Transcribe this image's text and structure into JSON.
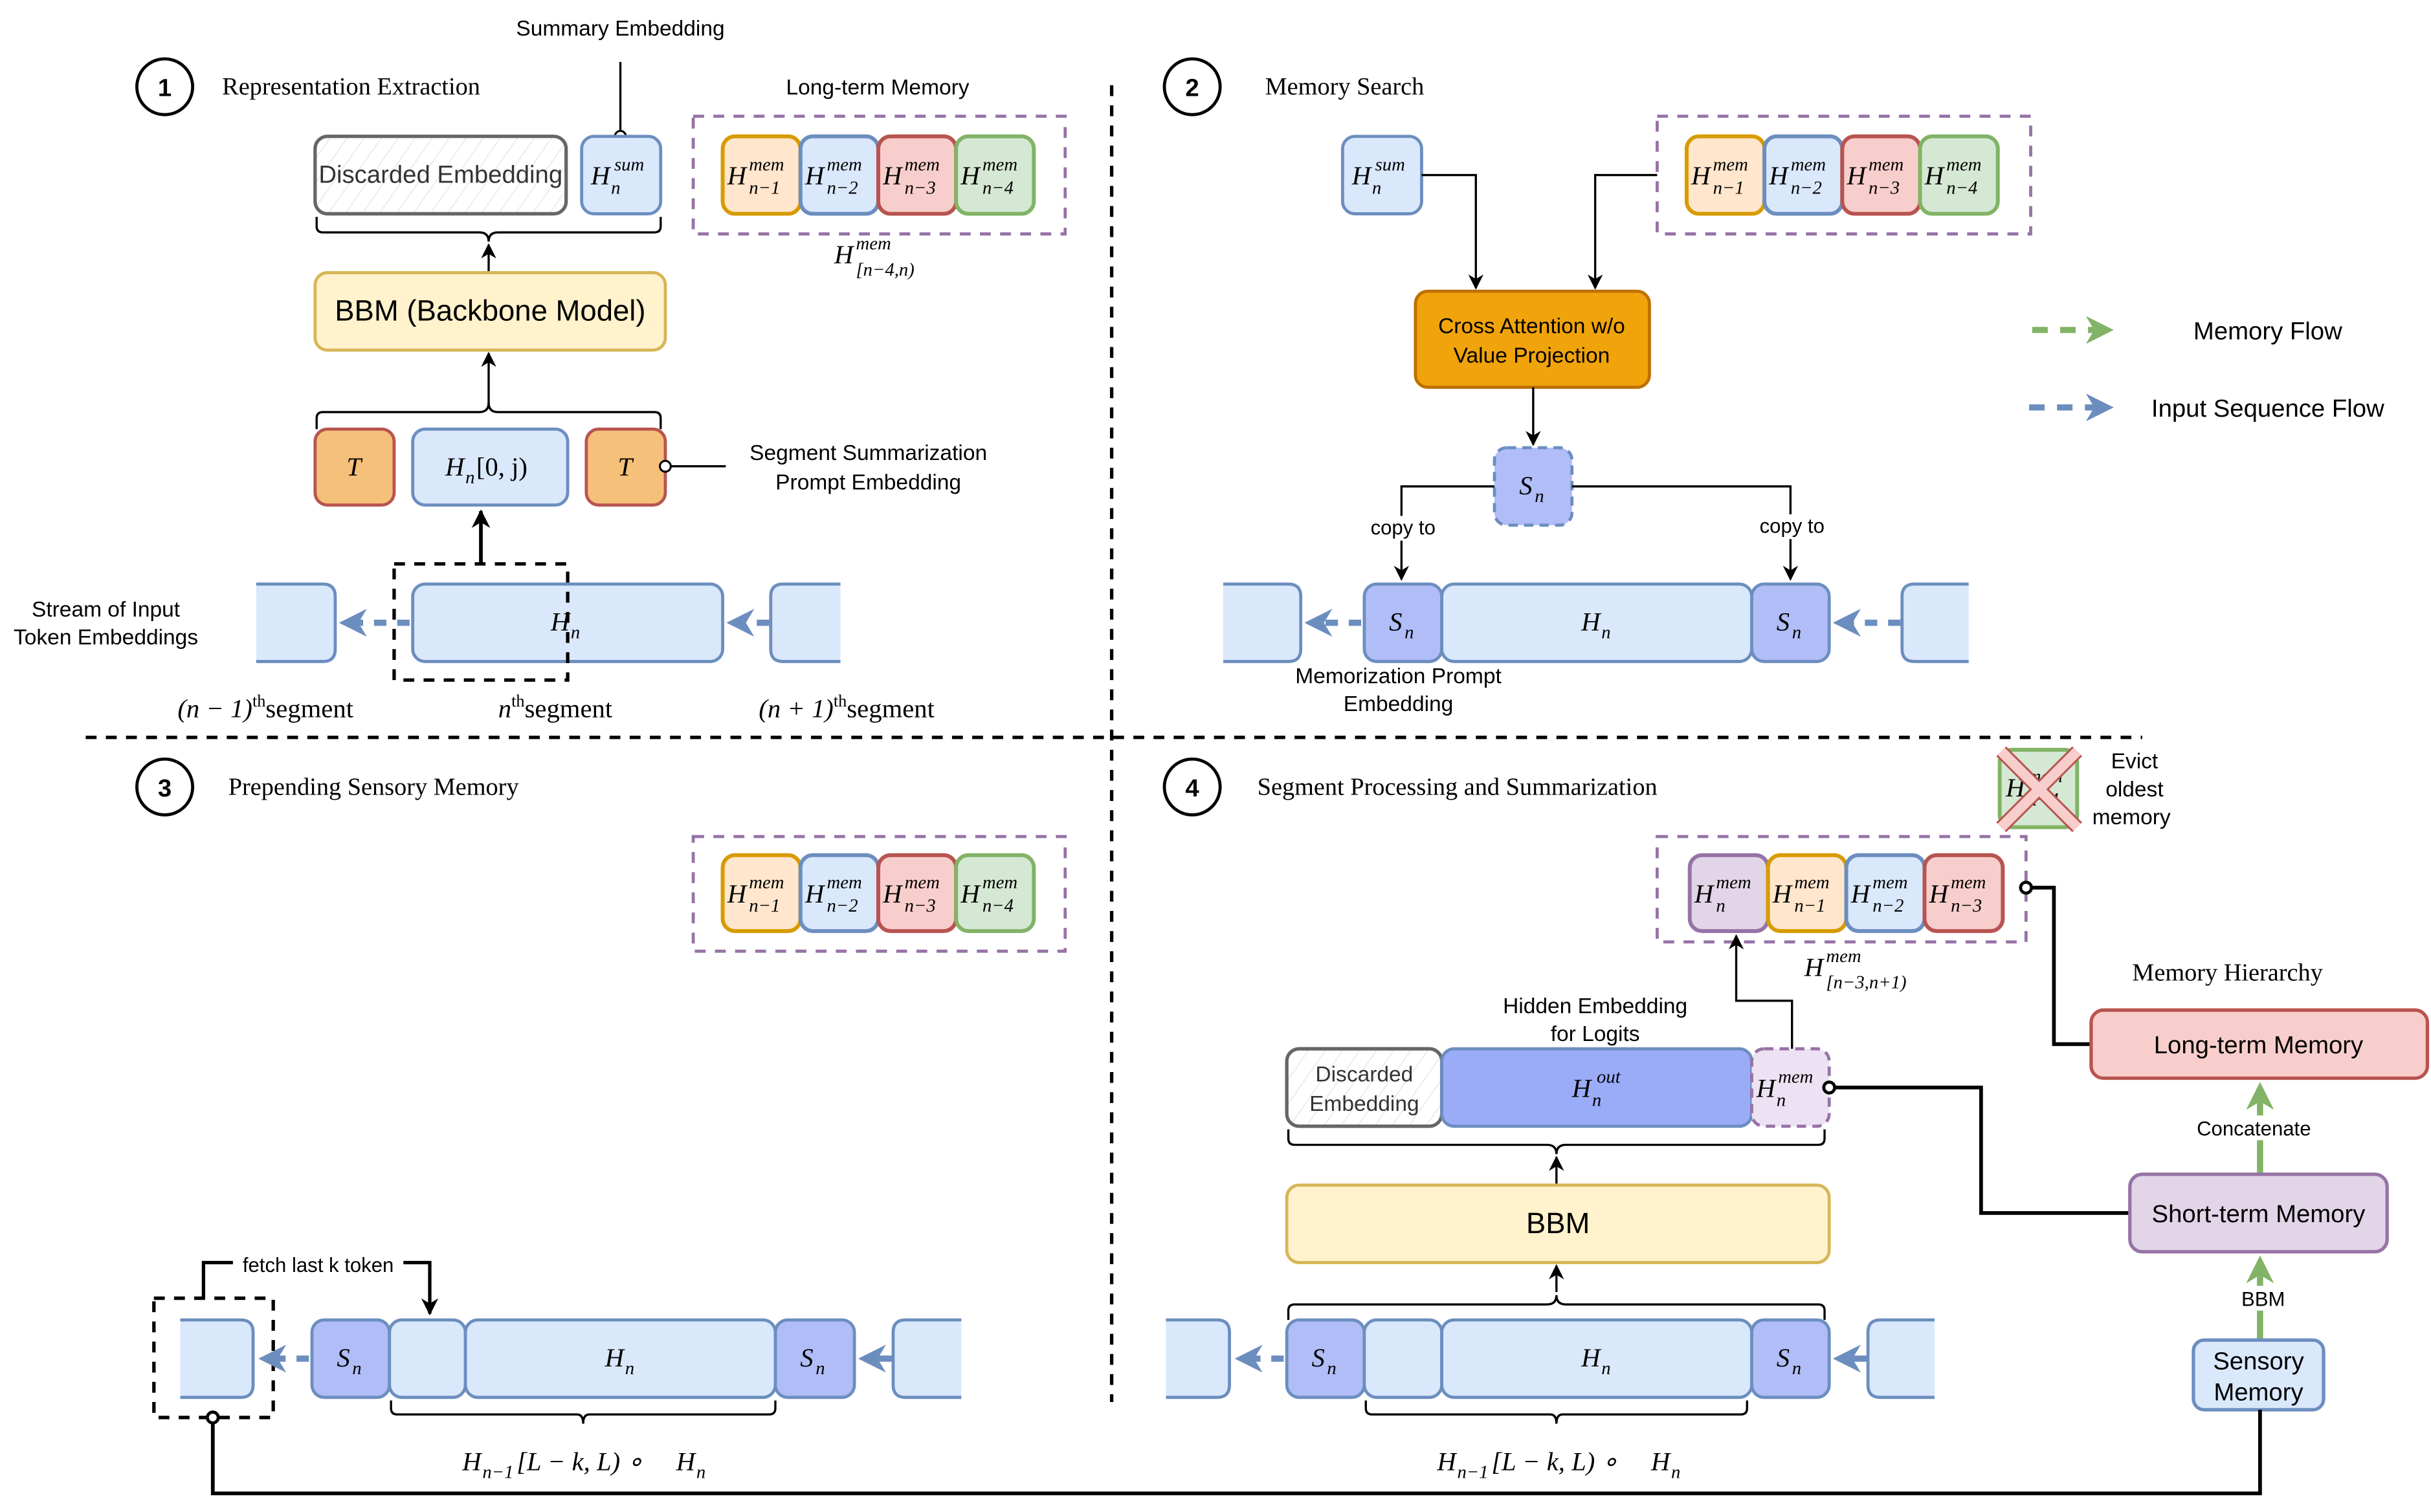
{
  "colors": {
    "blue_fill": "#dae8fc",
    "blue_stroke": "#6c8ebf",
    "sn_fill": "#b0bdf7",
    "hout_fill": "#9aabf8",
    "orange_fill": "#ffe6cc",
    "orange_stroke": "#d79b00",
    "red_fill": "#f8cecc",
    "red_stroke": "#b85450",
    "green_fill": "#d5e8d4",
    "green_stroke": "#82b366",
    "purple_fill": "#e1d5e7",
    "purple_stroke": "#9673a6",
    "t_fill": "#f5c07a",
    "cross_fill": "#f0a30a",
    "cross_stroke": "#bd7000",
    "bbm_fill": "#fff2cc",
    "bbm_stroke": "#d6b656",
    "memory_flow": "#82b366",
    "input_flow": "#6c8ebf"
  },
  "panel1": {
    "number": "1",
    "title": "Representation Extraction",
    "summary_embedding_label": "Summary Embedding",
    "discarded_label": "Discarded Embedding",
    "hsum": {
      "base": "H",
      "sup": "sum",
      "sub": "n"
    },
    "long_term_memory_label": "Long-term Memory",
    "memory_items": [
      {
        "base": "H",
        "sup": "mem",
        "sub": "n−1",
        "color": "orange"
      },
      {
        "base": "H",
        "sup": "mem",
        "sub": "n−2",
        "color": "blue"
      },
      {
        "base": "H",
        "sup": "mem",
        "sub": "n−3",
        "color": "red"
      },
      {
        "base": "H",
        "sup": "mem",
        "sub": "n−4",
        "color": "green"
      }
    ],
    "memory_range": {
      "base": "H",
      "sup": "mem",
      "sub": "[n−4,n)"
    },
    "bbm_label": "BBM (Backbone Model)",
    "token_t": "T",
    "hn_slice": {
      "base": "H",
      "sub": "n",
      "suffix": "[0, j)"
    },
    "segment_prompt_label": [
      "Segment Summarization",
      "Prompt Embedding"
    ],
    "stream_label": [
      "Stream of Input",
      "Token Embeddings"
    ],
    "hn": {
      "base": "H",
      "sub": "n"
    },
    "segment_labels": [
      {
        "math": "(n − 1)",
        "sup": "th",
        "text": "segment"
      },
      {
        "math": "n",
        "sup": "th",
        "text": "segment"
      },
      {
        "math": "(n + 1)",
        "sup": "th",
        "text": "segment"
      }
    ]
  },
  "panel2": {
    "number": "2",
    "title": "Memory Search",
    "hsum": {
      "base": "H",
      "sup": "sum",
      "sub": "n"
    },
    "memory_items": [
      {
        "base": "H",
        "sup": "mem",
        "sub": "n−1",
        "color": "orange"
      },
      {
        "base": "H",
        "sup": "mem",
        "sub": "n−2",
        "color": "blue"
      },
      {
        "base": "H",
        "sup": "mem",
        "sub": "n−3",
        "color": "red"
      },
      {
        "base": "H",
        "sup": "mem",
        "sub": "n−4",
        "color": "green"
      }
    ],
    "cross_attention_label": [
      "Cross Attention w/o",
      "Value Projection"
    ],
    "sn": {
      "base": "S",
      "sub": "n"
    },
    "copy_to_label": "copy to",
    "hn": {
      "base": "H",
      "sub": "n"
    },
    "memorization_prompt_label": [
      "Memorization Prompt",
      "Embedding"
    ]
  },
  "legend": {
    "items": [
      {
        "label": "Memory Flow",
        "color": "#82b366"
      },
      {
        "label": "Input Sequence Flow",
        "color": "#6c8ebf"
      }
    ]
  },
  "panel3": {
    "number": "3",
    "title": "Prepending Sensory Memory",
    "memory_items": [
      {
        "base": "H",
        "sup": "mem",
        "sub": "n−1",
        "color": "orange"
      },
      {
        "base": "H",
        "sup": "mem",
        "sub": "n−2",
        "color": "blue"
      },
      {
        "base": "H",
        "sup": "mem",
        "sub": "n−3",
        "color": "red"
      },
      {
        "base": "H",
        "sup": "mem",
        "sub": "n−4",
        "color": "green"
      }
    ],
    "fetch_label": "fetch last k token",
    "sn": {
      "base": "S",
      "sub": "n"
    },
    "hn": {
      "base": "H",
      "sub": "n"
    },
    "concat_label": {
      "base": "H",
      "sub": "n−1",
      "mid": "[L − k, L) ∘ ",
      "base2": "H",
      "sub2": "n"
    }
  },
  "panel4": {
    "number": "4",
    "title": "Segment Processing and Summarization",
    "evicted_item": {
      "base": "H",
      "sup": "mem",
      "sub": "n−4"
    },
    "evict_label": [
      "Evict",
      "oldest",
      "memory"
    ],
    "memory_items": [
      {
        "base": "H",
        "sup": "mem",
        "sub": "n",
        "color": "purple"
      },
      {
        "base": "H",
        "sup": "mem",
        "sub": "n−1",
        "color": "orange"
      },
      {
        "base": "H",
        "sup": "mem",
        "sub": "n−2",
        "color": "blue"
      },
      {
        "base": "H",
        "sup": "mem",
        "sub": "n−3",
        "color": "red"
      }
    ],
    "memory_range": {
      "base": "H",
      "sup": "mem",
      "sub": "[n−3,n+1)"
    },
    "hidden_embedding_label": [
      "Hidden Embedding",
      "for Logits"
    ],
    "discarded_label": [
      "Discarded",
      "Embedding"
    ],
    "hout": {
      "base": "H",
      "sup": "out",
      "sub": "n"
    },
    "hmem": {
      "base": "H",
      "sup": "mem",
      "sub": "n"
    },
    "bbm_label": "BBM",
    "sn": {
      "base": "S",
      "sub": "n"
    },
    "hn": {
      "base": "H",
      "sub": "n"
    },
    "concat_label": {
      "base": "H",
      "sub": "n−1",
      "mid": "[L − k, L) ∘ ",
      "base2": "H",
      "sub2": "n"
    }
  },
  "memory_hierarchy": {
    "title": "Memory Hierarchy",
    "long_term": "Long-term Memory",
    "concatenate": "Concatenate",
    "short_term": "Short-term Memory",
    "bbm": "BBM",
    "sensory": [
      "Sensory",
      "Memory"
    ]
  }
}
